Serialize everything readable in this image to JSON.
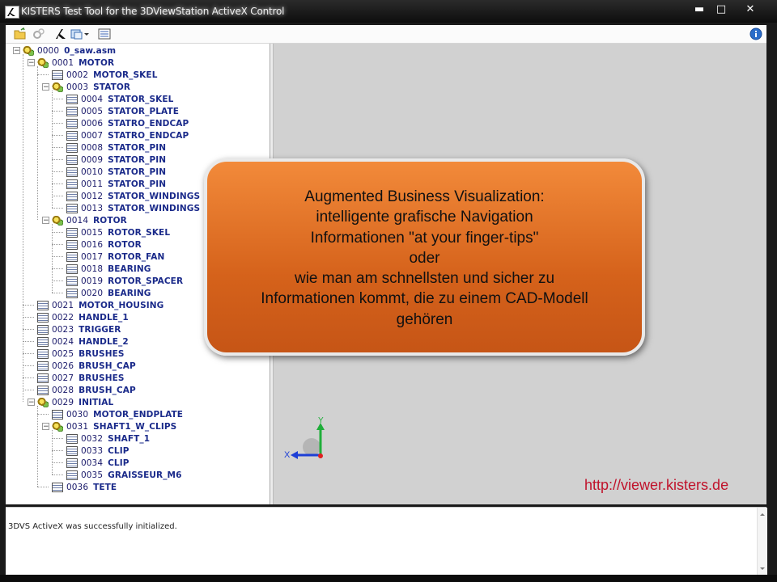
{
  "window": {
    "title": "KISTERS Test Tool for the 3DViewStation ActiveX Control",
    "minimize_glyph": "▬",
    "maximize_glyph": "□",
    "close_glyph": "✕"
  },
  "toolbar": {
    "icons": [
      "open-folder-icon",
      "settings-icon",
      "kisters-logo-icon",
      "view-dropdown-icon",
      "export-icon",
      "info-icon"
    ]
  },
  "tree": {
    "nodes": [
      {
        "num": "0000",
        "name": "0_saw.asm",
        "type": "asm",
        "depth": 0,
        "exp": "−"
      },
      {
        "num": "0001",
        "name": "MOTOR",
        "type": "asm",
        "depth": 1,
        "exp": "−"
      },
      {
        "num": "0002",
        "name": "MOTOR_SKEL",
        "type": "part",
        "depth": 2
      },
      {
        "num": "0003",
        "name": "STATOR",
        "type": "asm",
        "depth": 2,
        "exp": "−"
      },
      {
        "num": "0004",
        "name": "STATOR_SKEL",
        "type": "part",
        "depth": 3
      },
      {
        "num": "0005",
        "name": "STATOR_PLATE",
        "type": "part",
        "depth": 3
      },
      {
        "num": "0006",
        "name": "STATRO_ENDCAP",
        "type": "part",
        "depth": 3
      },
      {
        "num": "0007",
        "name": "STATRO_ENDCAP",
        "type": "part",
        "depth": 3
      },
      {
        "num": "0008",
        "name": "STATOR_PIN",
        "type": "part",
        "depth": 3
      },
      {
        "num": "0009",
        "name": "STATOR_PIN",
        "type": "part",
        "depth": 3
      },
      {
        "num": "0010",
        "name": "STATOR_PIN",
        "type": "part",
        "depth": 3
      },
      {
        "num": "0011",
        "name": "STATOR_PIN",
        "type": "part",
        "depth": 3
      },
      {
        "num": "0012",
        "name": "STATOR_WINDINGS",
        "type": "part",
        "depth": 3
      },
      {
        "num": "0013",
        "name": "STATOR_WINDINGS",
        "type": "part",
        "depth": 3
      },
      {
        "num": "0014",
        "name": "ROTOR",
        "type": "asm",
        "depth": 2,
        "exp": "−"
      },
      {
        "num": "0015",
        "name": "ROTOR_SKEL",
        "type": "part",
        "depth": 3
      },
      {
        "num": "0016",
        "name": "ROTOR",
        "type": "part",
        "depth": 3
      },
      {
        "num": "0017",
        "name": "ROTOR_FAN",
        "type": "part",
        "depth": 3
      },
      {
        "num": "0018",
        "name": "BEARING",
        "type": "part",
        "depth": 3
      },
      {
        "num": "0019",
        "name": "ROTOR_SPACER",
        "type": "part",
        "depth": 3
      },
      {
        "num": "0020",
        "name": "BEARING",
        "type": "part",
        "depth": 3
      },
      {
        "num": "0021",
        "name": "MOTOR_HOUSING",
        "type": "part",
        "depth": 1
      },
      {
        "num": "0022",
        "name": "HANDLE_1",
        "type": "part",
        "depth": 1
      },
      {
        "num": "0023",
        "name": "TRIGGER",
        "type": "part",
        "depth": 1
      },
      {
        "num": "0024",
        "name": "HANDLE_2",
        "type": "part",
        "depth": 1
      },
      {
        "num": "0025",
        "name": "BRUSHES",
        "type": "part",
        "depth": 1
      },
      {
        "num": "0026",
        "name": "BRUSH_CAP",
        "type": "part",
        "depth": 1
      },
      {
        "num": "0027",
        "name": "BRUSHES",
        "type": "part",
        "depth": 1
      },
      {
        "num": "0028",
        "name": "BRUSH_CAP",
        "type": "part",
        "depth": 1
      },
      {
        "num": "0029",
        "name": "INITIAL",
        "type": "asm",
        "depth": 1,
        "exp": "−"
      },
      {
        "num": "0030",
        "name": "MOTOR_ENDPLATE",
        "type": "part",
        "depth": 2
      },
      {
        "num": "0031",
        "name": "SHAFT1_W_CLIPS",
        "type": "asm",
        "depth": 2,
        "exp": "−"
      },
      {
        "num": "0032",
        "name": "SHAFT_1",
        "type": "part",
        "depth": 3
      },
      {
        "num": "0033",
        "name": "CLIP",
        "type": "part",
        "depth": 3
      },
      {
        "num": "0034",
        "name": "CLIP",
        "type": "part",
        "depth": 3
      },
      {
        "num": "0035",
        "name": "GRAISSEUR_M6",
        "type": "part",
        "depth": 3
      },
      {
        "num": "0036",
        "name": "TETE",
        "type": "part",
        "depth": 2
      }
    ]
  },
  "callout": {
    "lines": [
      "Augmented Business Visualization:",
      "intelligente grafische Navigation",
      "Informationen \"at your finger-tips\"",
      "oder",
      "wie man am schnellsten und sicher zu",
      "Informationen kommt, die zu einem CAD-Modell",
      "gehören"
    ]
  },
  "viewport": {
    "url": "http://viewer.kisters.de",
    "axis_x_label": "X",
    "axis_y_label": "Y"
  },
  "status": {
    "message": "3DVS ActiveX was successfully initialized."
  },
  "colors": {
    "callout_orange": "#d5621b",
    "url_red": "#c0122b",
    "tree_text": "#1a2a8a"
  }
}
